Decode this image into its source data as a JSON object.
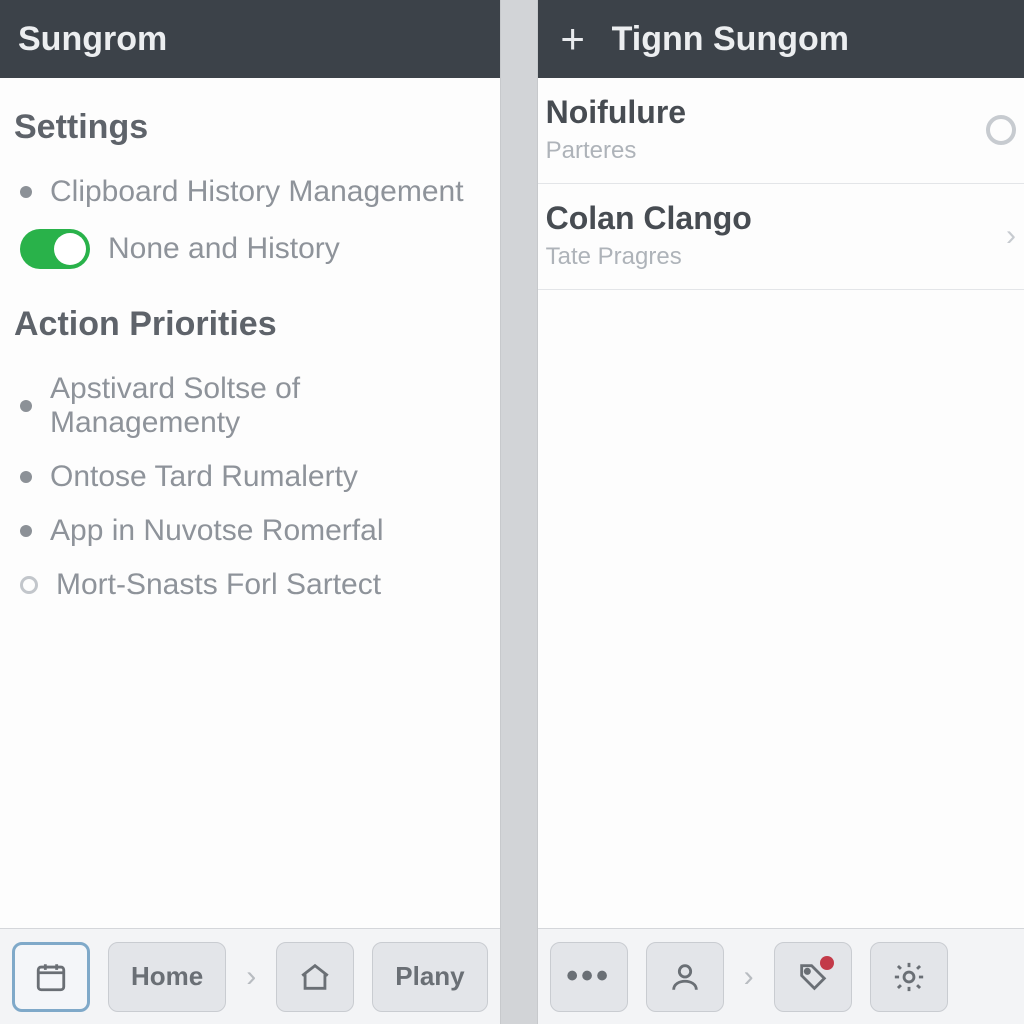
{
  "left": {
    "header": {
      "title": "Sungrom"
    },
    "sections": [
      {
        "heading": "Settings",
        "items": [
          {
            "kind": "bullet",
            "label": "Clipboard History Management"
          },
          {
            "kind": "toggle",
            "label": "None and History",
            "on": true
          }
        ]
      },
      {
        "heading": "Action Priorities",
        "items": [
          {
            "kind": "bullet",
            "label": "Apstivard Soltse of Managementy"
          },
          {
            "kind": "bullet",
            "label": "Ontose Tard Rumalerty"
          },
          {
            "kind": "bullet",
            "label": "App in Nuvotse Romerfal"
          },
          {
            "kind": "open",
            "label": "Mort-Snasts Forl Sartect"
          }
        ]
      }
    ],
    "footer": {
      "items": [
        {
          "type": "icon",
          "name": "calendar-icon",
          "selected": true
        },
        {
          "type": "text",
          "label": "Home"
        },
        {
          "type": "sep"
        },
        {
          "type": "icon",
          "name": "home-icon"
        },
        {
          "type": "text",
          "label": "Plany"
        }
      ]
    }
  },
  "right": {
    "header": {
      "title": "Tignn Sungom",
      "add": "+"
    },
    "list": [
      {
        "title": "Noifulure",
        "sub": "Parteres",
        "trail": "ring"
      },
      {
        "title": "Colan Clango",
        "sub": "Tate Pragres",
        "trail": "chev"
      }
    ],
    "footer": {
      "items": [
        {
          "type": "icon",
          "name": "more-icon"
        },
        {
          "type": "icon",
          "name": "person-icon"
        },
        {
          "type": "sep"
        },
        {
          "type": "icon",
          "name": "tag-icon",
          "badge": true
        },
        {
          "type": "icon",
          "name": "gear-icon"
        }
      ]
    }
  }
}
